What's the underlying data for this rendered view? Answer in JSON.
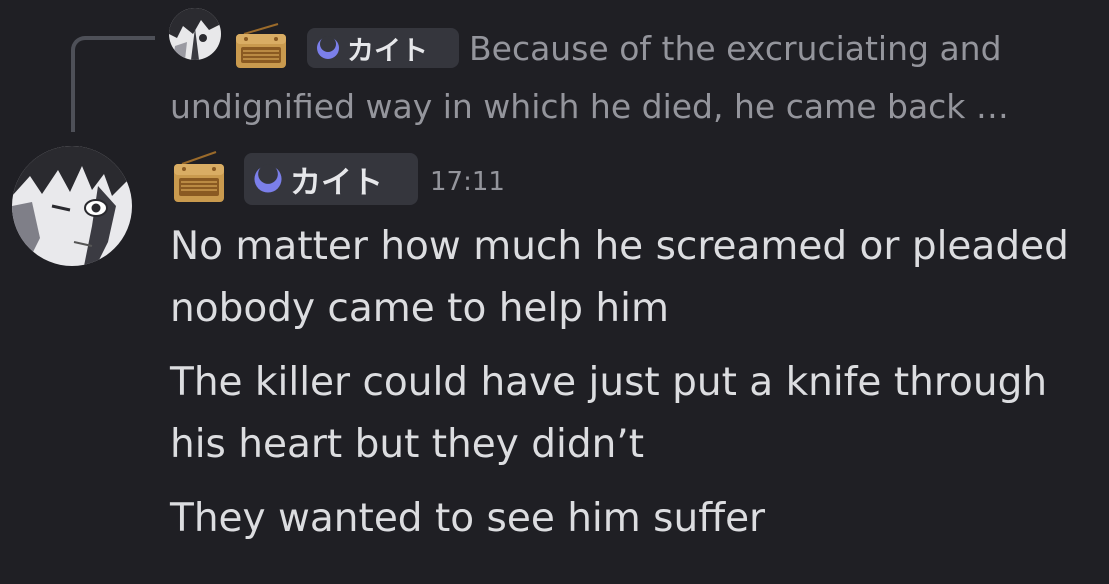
{
  "reply": {
    "tag": "カイト",
    "text_line1": "Because of the excruciating and",
    "text_line2": "undignified way in which he died, he came back …"
  },
  "message": {
    "tag": "カイト",
    "timestamp": "17:11",
    "lines": [
      "No matter how much he screamed or pleaded nobody came to help him",
      "The killer could have just put a knife through his heart but they didn’t",
      "They wanted to see him suffer"
    ]
  },
  "icons": {
    "radio": "radio-icon",
    "tag": "crescent-moon-icon",
    "avatar": "avatar"
  },
  "colors": {
    "background": "#1f1f24",
    "pill": "#35363d",
    "muted_text": "#94959c",
    "body_text": "#dcdde0",
    "tag_icon": "#7b7fea"
  }
}
